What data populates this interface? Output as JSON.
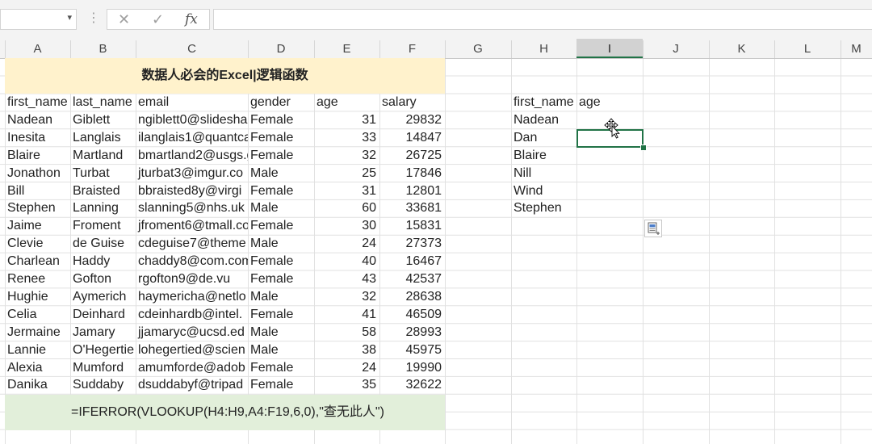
{
  "formula_bar": {
    "name_box": "",
    "cancel_icon": "✕",
    "enter_icon": "✓",
    "fx_icon": "fx",
    "formula": ""
  },
  "columns": [
    "A",
    "B",
    "C",
    "D",
    "E",
    "F",
    "G",
    "H",
    "I",
    "J",
    "K",
    "L",
    "M"
  ],
  "selected_column": "I",
  "title": "数据人必会的Excel|逻辑函数",
  "table": {
    "headers": [
      "first_name",
      "last_name",
      "email",
      "gender",
      "age",
      "salary"
    ],
    "rows": [
      [
        "Nadean",
        "Giblett",
        "ngiblett0@slidesha",
        "Female",
        "31",
        "29832"
      ],
      [
        "Inesita",
        "Langlais",
        "ilanglais1@quantca",
        "Female",
        "33",
        "14847"
      ],
      [
        "Blaire",
        "Martland",
        "bmartland2@usgs.g",
        "Female",
        "32",
        "26725"
      ],
      [
        "Jonathon",
        "Turbat",
        "jturbat3@imgur.co",
        "Male",
        "25",
        "17846"
      ],
      [
        "Bill",
        "Braisted",
        "bbraisted8y@virgi",
        "Female",
        "31",
        "12801"
      ],
      [
        "Stephen",
        "Lanning",
        "slanning5@nhs.uk",
        "Male",
        "60",
        "33681"
      ],
      [
        "Jaime",
        "Froment",
        "jfroment6@tmall.co",
        "Female",
        "30",
        "15831"
      ],
      [
        "Clevie",
        "de Guise",
        "cdeguise7@theme",
        "Male",
        "24",
        "27373"
      ],
      [
        "Charlean",
        "Haddy",
        "chaddy8@com.com",
        "Female",
        "40",
        "16467"
      ],
      [
        "Renee",
        "Gofton",
        "rgofton9@de.vu",
        "Female",
        "43",
        "42537"
      ],
      [
        "Hughie",
        "Aymerich",
        "haymericha@netlo",
        "Male",
        "32",
        "28638"
      ],
      [
        "Celia",
        "Deinhard",
        "cdeinhardb@intel.",
        "Female",
        "41",
        "46509"
      ],
      [
        "Jermaine",
        "Jamary",
        "jjamaryc@ucsd.ed",
        "Male",
        "58",
        "28993"
      ],
      [
        "Lannie",
        "O'Hegertie",
        "lohegertied@scien",
        "Male",
        "38",
        "45975"
      ],
      [
        "Alexia",
        "Mumford",
        "amumforde@adob",
        "Female",
        "24",
        "19990"
      ],
      [
        "Danika",
        "Suddaby",
        "dsuddabyf@tripad",
        "Female",
        "35",
        "32622"
      ]
    ]
  },
  "lookup": {
    "headers": [
      "first_name",
      "age"
    ],
    "names": [
      "Nadean",
      "Dan",
      "Blaire",
      "Nill",
      "Wind",
      "Stephen"
    ]
  },
  "formula_note": "=IFERROR(VLOOKUP(H4:H9,A4:F19,6,0),\"查无此人\")",
  "icons": [
    "cancel-icon",
    "enter-icon",
    "insert-function-icon",
    "move-cursor-icon",
    "paste-options-icon"
  ],
  "colors": {
    "title_bg": "#fff2cc",
    "note_bg": "#e2efda",
    "selection": "#217346",
    "gridline": "#e1e1e1"
  }
}
